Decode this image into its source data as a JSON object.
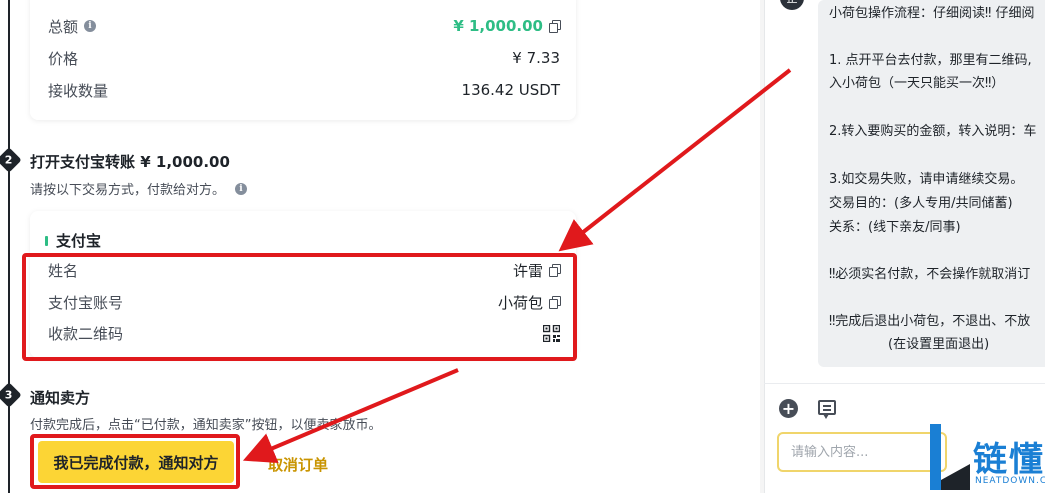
{
  "order_summary": {
    "total_label": "总额",
    "total_value": "¥ 1,000.00",
    "price_label": "价格",
    "price_value": "¥ 7.33",
    "receive_label": "接收数量",
    "receive_value": "136.42 USDT"
  },
  "step2": {
    "number": "2",
    "title": "打开支付宝转账 ¥ 1,000.00",
    "subtitle": "请按以下交易方式，付款给对方。"
  },
  "payment": {
    "method_name": "支付宝",
    "name_label": "姓名",
    "name_value": "许雷",
    "account_label": "支付宝账号",
    "account_value": "小荷包",
    "qr_label": "收款二维码"
  },
  "step3": {
    "number": "3",
    "title": "通知卖方",
    "subtitle": "付款完成后，点击“已付款，通知卖家”按钮，以便卖家放币。"
  },
  "actions": {
    "confirm_label": "我已完成付款，通知对方",
    "cancel_label": "取消订单"
  },
  "chat": {
    "avatar_initial": "正",
    "message_lines": [
      "小荷包操作流程：仔细阅读‼ 仔细阅",
      "1. 点开平台去付款，那里有二维码,",
      "入小荷包（一天只能买一次‼）",
      "2.转入要购买的金额，转入说明：车",
      "3.如交易失败，请申请继续交易。",
      "交易目的：(多人专用/共同储蓄)",
      "关系：(线下亲友/同事)",
      "‼必须实名付款，不会操作就取消订",
      "‼完成后退出小荷包，不退出、不放",
      "(在设置里面退出)"
    ],
    "input_placeholder": "请输入内容..."
  },
  "watermark": {
    "brand": "链懂",
    "domain": "NEATDOWN.COM"
  },
  "colors": {
    "total_green": "#2ebd85",
    "highlight_red": "#e0191c",
    "button_yellow": "#fcd535",
    "cancel_gold": "#c99400",
    "logo_blue": "#1a7fd4"
  }
}
